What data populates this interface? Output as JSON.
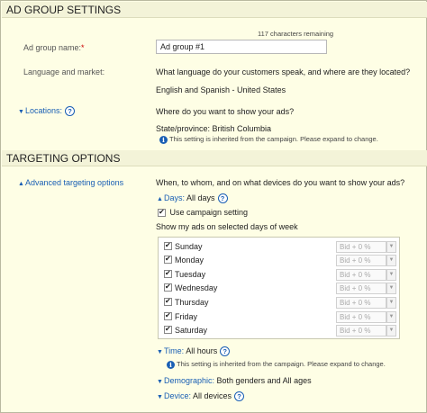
{
  "ad_group_settings": {
    "title": "AD GROUP SETTINGS",
    "chars_remaining": "117 characters remaining",
    "name_label": "Ad group name:",
    "name_required": "*",
    "name_value": "Ad group #1",
    "lang_label": "Language and market:",
    "lang_question": "What language do your customers speak, and where are they located?",
    "lang_value": "English and Spanish - United States",
    "locations_label": "Locations:",
    "locations_question": "Where do you want to show your ads?",
    "locations_value": "State/province: British Columbia",
    "locations_note": "This setting is inherited from the campaign. Please expand to change."
  },
  "targeting_options": {
    "title": "TARGETING OPTIONS",
    "advanced_label": "Advanced targeting options",
    "question": "When, to whom, and on what devices do you want to show your ads?",
    "days": {
      "label": "Days:",
      "value": "All days",
      "use_campaign_label": "Use campaign setting",
      "use_campaign_checked": true,
      "show_label": "Show my ads on selected days of week",
      "bid_placeholder": "Bid + 0 %",
      "items": [
        {
          "name": "Sunday",
          "checked": true
        },
        {
          "name": "Monday",
          "checked": true
        },
        {
          "name": "Tuesday",
          "checked": true
        },
        {
          "name": "Wednesday",
          "checked": true
        },
        {
          "name": "Thursday",
          "checked": true
        },
        {
          "name": "Friday",
          "checked": true
        },
        {
          "name": "Saturday",
          "checked": true
        }
      ]
    },
    "time": {
      "label": "Time:",
      "value": "All hours",
      "note": "This setting is inherited from the campaign. Please expand to change."
    },
    "demographic": {
      "label": "Demographic:",
      "value": "Both genders and All ages"
    },
    "device": {
      "label": "Device:",
      "value": "All devices"
    }
  },
  "icons": {
    "help": "?",
    "info": "i",
    "expand": "▼",
    "collapse": "▲",
    "dropdown": "▼"
  }
}
